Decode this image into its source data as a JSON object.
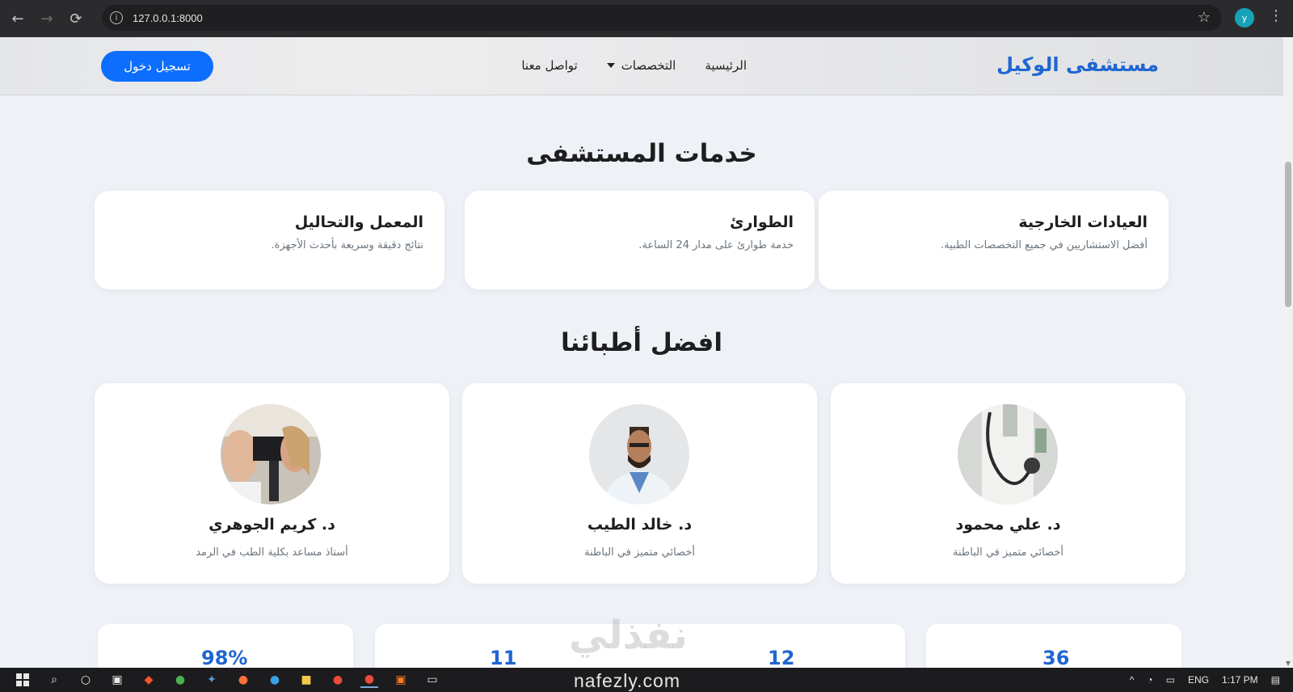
{
  "browser": {
    "url": "127.0.0.1:8000",
    "profile_initial": "y"
  },
  "navbar": {
    "brand": "مستشفى الوكيل",
    "menu": [
      "الرئيسية",
      "التخصصات",
      "تواصل معنا"
    ],
    "login_label": "تسجيل دخول"
  },
  "services": {
    "title": "خدمات المستشفى",
    "items": [
      {
        "title": "العيادات الخارجية",
        "desc": "أفضل الاستشاريين في جميع التخصصات الطبية."
      },
      {
        "title": "الطوارئ",
        "desc": "خدمة طوارئ على مدار 24 الساعة."
      },
      {
        "title": "المعمل والتحاليل",
        "desc": "نتائج دقيقة وسريعة بأحدث الأجهزة."
      }
    ]
  },
  "doctors": {
    "title": "افضل أطبائنا",
    "items": [
      {
        "name": "د. علي محمود",
        "title": "أخصائي متميز في الباطنة",
        "photo": "doctor-stethoscope-photo"
      },
      {
        "name": "د. خالد الطيب",
        "title": "أخصائي متميز في الباطنة",
        "photo": "doctor-portrait-photo"
      },
      {
        "name": "د. كريم الجوهري",
        "title": "أستاذ مساعد بكلية الطب في الرمد",
        "photo": "eye-exam-photo"
      }
    ]
  },
  "stats": [
    "36",
    "12",
    "11",
    "98%"
  ],
  "watermark": "نفذلي",
  "taskbar": {
    "footer_text": "nafezly.com",
    "lang": "ENG",
    "time": "1:17 PM"
  },
  "colors": {
    "accent": "#0d6efd",
    "brand": "#1f66d1"
  }
}
